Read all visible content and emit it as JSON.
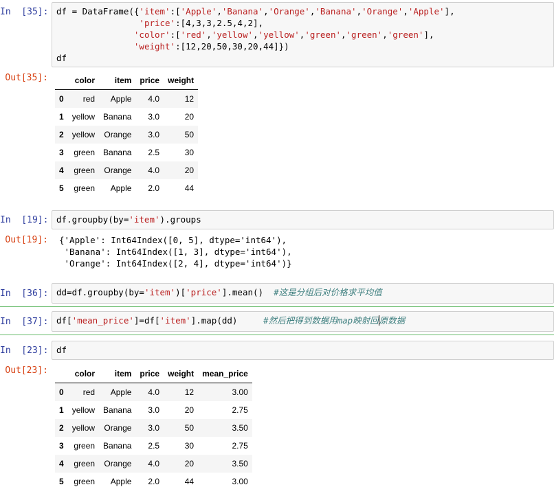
{
  "cells": [
    {
      "in_prompt": "In  [35]:",
      "out_prompt": "Out[35]:",
      "code": [
        [
          [
            "df = DataFrame({",
            "p"
          ],
          [
            "'item'",
            "s"
          ],
          [
            ":[",
            "p"
          ],
          [
            "'Apple'",
            "s"
          ],
          [
            ",",
            "p"
          ],
          [
            "'Banana'",
            "s"
          ],
          [
            ",",
            "p"
          ],
          [
            "'Orange'",
            "s"
          ],
          [
            ",",
            "p"
          ],
          [
            "'Banana'",
            "s"
          ],
          [
            ",",
            "p"
          ],
          [
            "'Orange'",
            "s"
          ],
          [
            ",",
            "p"
          ],
          [
            "'Apple'",
            "s"
          ],
          [
            "],",
            "p"
          ]
        ],
        [
          [
            "                ",
            "p"
          ],
          [
            "'price'",
            "s"
          ],
          [
            ":[4,3,3,2.5,4,2],",
            "p"
          ]
        ],
        [
          [
            "               ",
            "p"
          ],
          [
            "'color'",
            "s"
          ],
          [
            ":[",
            "p"
          ],
          [
            "'red'",
            "s"
          ],
          [
            ",",
            "p"
          ],
          [
            "'yellow'",
            "s"
          ],
          [
            ",",
            "p"
          ],
          [
            "'yellow'",
            "s"
          ],
          [
            ",",
            "p"
          ],
          [
            "'green'",
            "s"
          ],
          [
            ",",
            "p"
          ],
          [
            "'green'",
            "s"
          ],
          [
            ",",
            "p"
          ],
          [
            "'green'",
            "s"
          ],
          [
            "],",
            "p"
          ]
        ],
        [
          [
            "               ",
            "p"
          ],
          [
            "'weight'",
            "s"
          ],
          [
            ":[12,20,50,30,20,44]})",
            "p"
          ]
        ],
        [
          [
            "df",
            "p"
          ]
        ]
      ],
      "table": {
        "columns": [
          "color",
          "item",
          "price",
          "weight"
        ],
        "rows": [
          [
            "0",
            "red",
            "Apple",
            "4.0",
            "12"
          ],
          [
            "1",
            "yellow",
            "Banana",
            "3.0",
            "20"
          ],
          [
            "2",
            "yellow",
            "Orange",
            "3.0",
            "50"
          ],
          [
            "3",
            "green",
            "Banana",
            "2.5",
            "30"
          ],
          [
            "4",
            "green",
            "Orange",
            "4.0",
            "20"
          ],
          [
            "5",
            "green",
            "Apple",
            "2.0",
            "44"
          ]
        ]
      }
    },
    {
      "in_prompt": "In  [19]:",
      "out_prompt": "Out[19]:",
      "code": [
        [
          [
            "df.groupby(by=",
            "p"
          ],
          [
            "'item'",
            "s"
          ],
          [
            ").groups",
            "p"
          ]
        ]
      ],
      "stdout": "{'Apple': Int64Index([0, 5], dtype='int64'),\n 'Banana': Int64Index([1, 3], dtype='int64'),\n 'Orange': Int64Index([2, 4], dtype='int64')}"
    },
    {
      "in_prompt": "In  [36]:",
      "code": [
        [
          [
            "dd=df.groupby(by=",
            "p"
          ],
          [
            "'item'",
            "s"
          ],
          [
            ")[",
            "p"
          ],
          [
            "'price'",
            "s"
          ],
          [
            "].mean()  ",
            "p"
          ],
          [
            "#这是分组后对价格求平均值",
            "c"
          ]
        ]
      ]
    },
    {
      "in_prompt": "In  [37]:",
      "code": [
        [
          [
            "df[",
            "p"
          ],
          [
            "'mean_price'",
            "s"
          ],
          [
            "]=df[",
            "p"
          ],
          [
            "'item'",
            "s"
          ],
          [
            "].map(dd)     ",
            "p"
          ],
          [
            "#然后把得到数据用map映射回",
            "c"
          ],
          [
            "原数据",
            "c"
          ]
        ]
      ]
    },
    {
      "in_prompt": "In  [23]:",
      "out_prompt": "Out[23]:",
      "code": [
        [
          [
            "df",
            "p"
          ]
        ]
      ],
      "table": {
        "columns": [
          "color",
          "item",
          "price",
          "weight",
          "mean_price"
        ],
        "rows": [
          [
            "0",
            "red",
            "Apple",
            "4.0",
            "12",
            "3.00"
          ],
          [
            "1",
            "yellow",
            "Banana",
            "3.0",
            "20",
            "2.75"
          ],
          [
            "2",
            "yellow",
            "Orange",
            "3.0",
            "50",
            "3.50"
          ],
          [
            "3",
            "green",
            "Banana",
            "2.5",
            "30",
            "2.75"
          ],
          [
            "4",
            "green",
            "Orange",
            "4.0",
            "20",
            "3.50"
          ],
          [
            "5",
            "green",
            "Apple",
            "2.0",
            "44",
            "3.00"
          ]
        ]
      }
    }
  ],
  "colors": {
    "prompt_in": "#303f9f",
    "prompt_out": "#d84315",
    "string": "#ba2121",
    "comment": "#408080",
    "selected_cell": "#66bb6a"
  }
}
